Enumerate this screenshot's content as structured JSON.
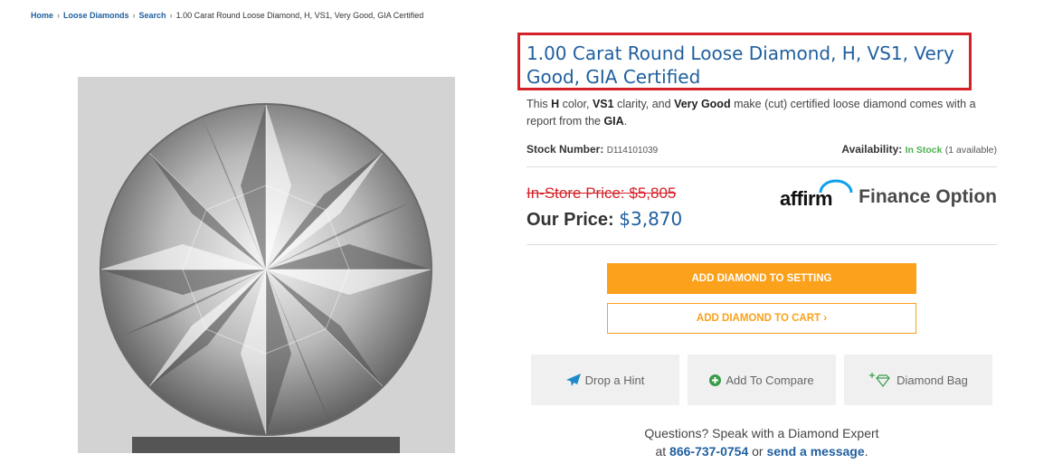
{
  "breadcrumb": {
    "home": "Home",
    "loose_diamonds": "Loose Diamonds",
    "search": "Search",
    "current": "1.00 Carat Round Loose Diamond, H, VS1, Very Good, GIA Certified",
    "separator": "›"
  },
  "product": {
    "title": "1.00 Carat Round Loose Diamond, H, VS1, Very Good, GIA Certified",
    "description": {
      "p1": "This ",
      "color": "H",
      "p2": " color, ",
      "clarity": "VS1",
      "p3": " clarity, and ",
      "cut": "Very Good",
      "p4": " make (cut) certified loose diamond comes with a report from the ",
      "lab": "GIA",
      "p5": "."
    },
    "stock_label": "Stock Number:",
    "stock_number": "D114101039",
    "availability_label": "Availability:",
    "availability_status": "In Stock",
    "availability_count": "(1 available)",
    "instore_price": "In-Store Price: $5,805",
    "our_price_label": "Our Price:",
    "our_price": "$3,870",
    "affirm_logo": "affirm",
    "finance_label": "Finance Option"
  },
  "buttons": {
    "add_to_setting": "ADD DIAMOND TO SETTING",
    "add_to_cart": "ADD DIAMOND TO CART ›"
  },
  "actions": {
    "hint": "Drop a Hint",
    "compare": "Add To Compare",
    "bag": "Diamond Bag"
  },
  "questions": {
    "line1": "Questions? Speak with a Diamond Expert",
    "at": "at ",
    "phone": "866-737-0754",
    "or": " or ",
    "message_link": "send a message",
    "end": "."
  },
  "colors": {
    "accent_orange": "#fba11b",
    "link_blue": "#1f5f9e",
    "highlight_red": "#d62027",
    "instock_green": "#4caf50"
  },
  "icons": [
    "paper-plane-icon",
    "plus-circle-icon",
    "diamond-plus-icon"
  ]
}
